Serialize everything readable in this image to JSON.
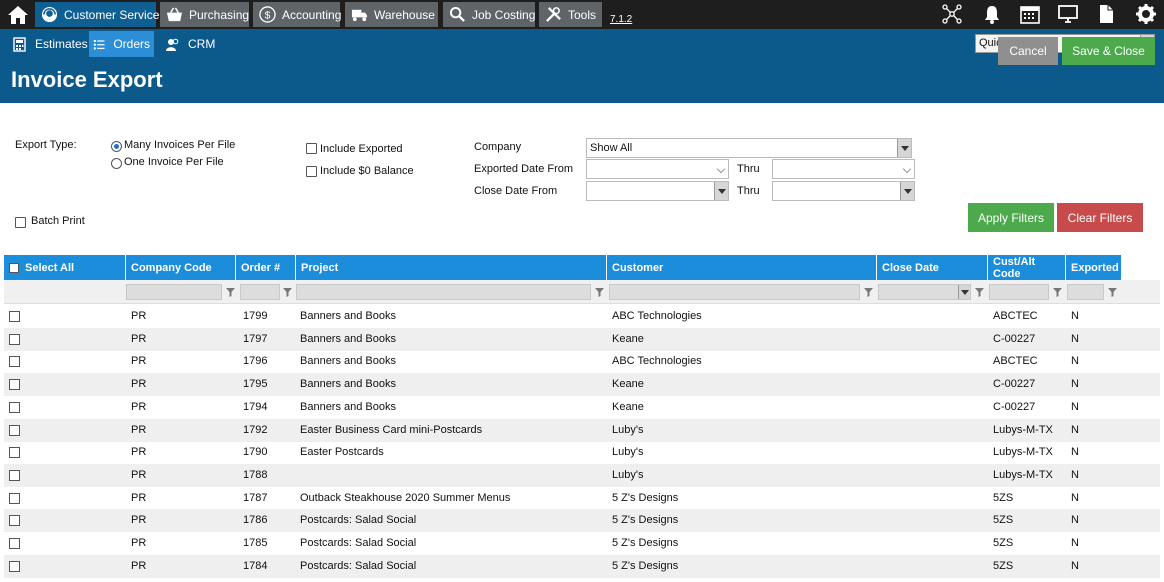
{
  "topnav": {
    "tabs": [
      {
        "label": "Customer Service",
        "icon": "headset-icon"
      },
      {
        "label": "Purchasing",
        "icon": "basket-icon"
      },
      {
        "label": "Accounting",
        "icon": "dollar-icon"
      },
      {
        "label": "Warehouse",
        "icon": "truck-icon"
      },
      {
        "label": "Job Costing",
        "icon": "magnifier-icon"
      },
      {
        "label": "Tools",
        "icon": "tools-icon"
      }
    ],
    "version": "7.1.2",
    "right_icons": [
      "network-icon",
      "bell-icon",
      "calendar-icon",
      "monitor-icon",
      "document-icon",
      "gear-icon"
    ]
  },
  "subnav": {
    "tabs": [
      {
        "label": "Estimates",
        "icon": "calculator-icon"
      },
      {
        "label": "Orders",
        "icon": "list-icon"
      },
      {
        "label": "CRM",
        "icon": "users-icon"
      }
    ],
    "quicklinks": "QuickLinks"
  },
  "page": {
    "title": "Invoice Export",
    "cancel_label": "Cancel",
    "save_label": "Save & Close"
  },
  "filters": {
    "export_type_label": "Export Type:",
    "radio_many": "Many Invoices Per File",
    "radio_one": "One Invoice Per File",
    "selected_export_type": "Many Invoices Per File",
    "include_exported": "Include Exported",
    "include_zero": "Include $0 Balance",
    "batch_print": "Batch Print",
    "company_label": "Company",
    "company_value": "Show All",
    "exported_date_label": "Exported Date From",
    "close_date_label": "Close Date From",
    "thru_label": "Thru",
    "apply_label": "Apply Filters",
    "clear_label": "Clear Filters"
  },
  "table": {
    "headers": [
      "Select All",
      "Company Code",
      "Order #",
      "Project",
      "Customer",
      "Close Date",
      "Cust/Alt Code",
      "Exported"
    ],
    "rows": [
      [
        "PR",
        "1799",
        "Banners and Books",
        "ABC Technologies",
        "",
        "ABCTEC",
        "N"
      ],
      [
        "PR",
        "1797",
        "Banners and Books",
        "Keane",
        "",
        "C-00227",
        "N"
      ],
      [
        "PR",
        "1796",
        "Banners and Books",
        "ABC Technologies",
        "",
        "ABCTEC",
        "N"
      ],
      [
        "PR",
        "1795",
        "Banners and Books",
        "Keane",
        "",
        "C-00227",
        "N"
      ],
      [
        "PR",
        "1794",
        "Banners and Books",
        "Keane",
        "",
        "C-00227",
        "N"
      ],
      [
        "PR",
        "1792",
        "Easter Business Card mini-Postcards",
        "Luby's",
        "",
        "Lubys-M-TX",
        "N"
      ],
      [
        "PR",
        "1790",
        "Easter Postcards",
        "Luby's",
        "",
        "Lubys-M-TX",
        "N"
      ],
      [
        "PR",
        "1788",
        "",
        "Luby's",
        "",
        "Lubys-M-TX",
        "N"
      ],
      [
        "PR",
        "1787",
        "Outback Steakhouse 2020 Summer Menus",
        "5 Z's Designs",
        "",
        "5ZS",
        "N"
      ],
      [
        "PR",
        "1786",
        "Postcards: Salad Social",
        "5 Z's Designs",
        "",
        "5ZS",
        "N"
      ],
      [
        "PR",
        "1785",
        "Postcards: Salad Social",
        "5 Z's Designs",
        "",
        "5ZS",
        "N"
      ],
      [
        "PR",
        "1784",
        "Postcards: Salad Social",
        "5 Z's Designs",
        "",
        "5ZS",
        "N"
      ]
    ]
  }
}
